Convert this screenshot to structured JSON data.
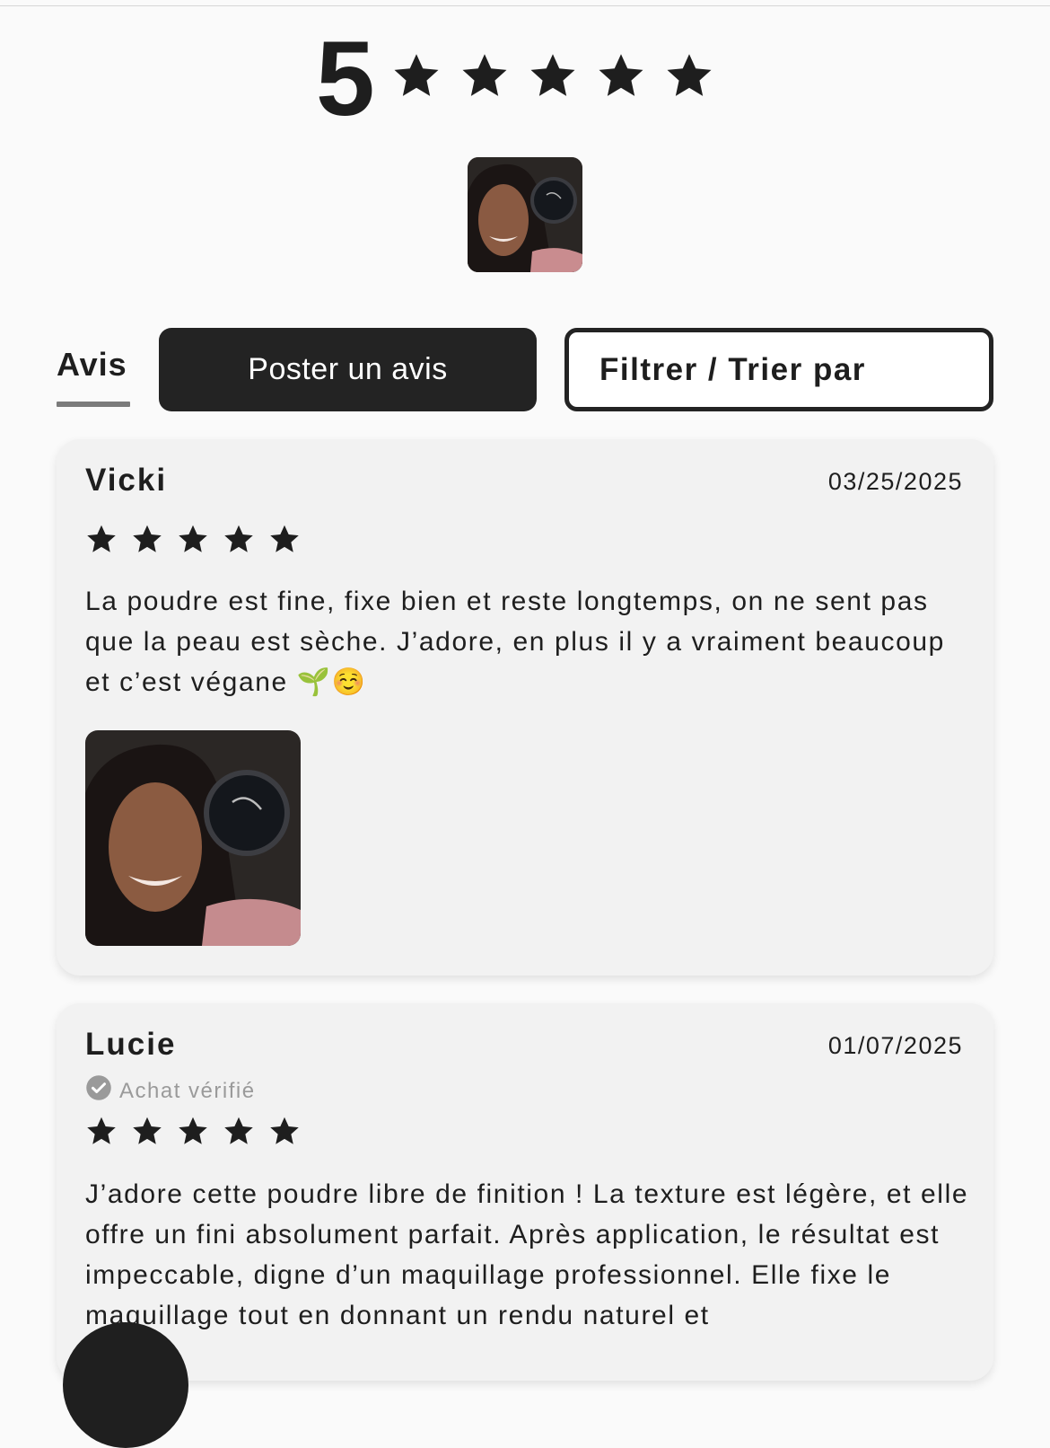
{
  "summary": {
    "average_rating": "5",
    "rating_value": 5,
    "rating_max": 5
  },
  "tabs": {
    "reviews_label": "Avis"
  },
  "actions": {
    "post_review_label": "Poster un avis",
    "filter_sort_label": "Filtrer / Trier par"
  },
  "reviews": [
    {
      "author": "Vicki",
      "date": "03/25/2025",
      "rating": 5,
      "text": "La poudre est fine, fixe bien et reste longtemps, on ne sent pas que la peau est sèche. J’adore, en plus il y a vraiment beaucoup et c’est végane 🌱☺️",
      "has_photo": true
    },
    {
      "author": "Lucie",
      "date": "01/07/2025",
      "verified_label": "Achat vérifié",
      "rating": 5,
      "text": "J’adore cette poudre libre de finition ! La texture est légère, et elle offre un fini absolument parfait. Après application, le résultat est impeccable, digne d’un maquillage professionnel. Elle fixe le maquillage tout en donnant un rendu naturel et"
    }
  ],
  "colors": {
    "star": "#1e1e1e",
    "primary_button": "#232323",
    "card_background": "#f2f2f2",
    "verified_gray": "#9a9a9a"
  },
  "icons": [
    "star-icon",
    "check-circle-icon"
  ]
}
